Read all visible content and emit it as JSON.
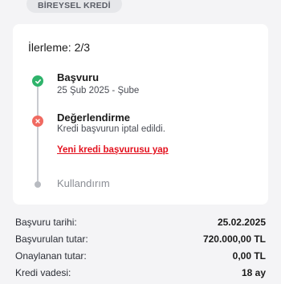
{
  "header": {
    "badge": "BİREYSEL KREDİ"
  },
  "progress": {
    "title": "İlerleme: 2/3",
    "steps": [
      {
        "title": "Başvuru",
        "subtitle": "25 Şub 2025 - Şube",
        "status": "completed",
        "icon": "check-icon"
      },
      {
        "title": "Değerlendirme",
        "subtitle": "Kredi başvurun iptal edildi.",
        "status": "failed",
        "icon": "close-icon",
        "link": "Yeni kredi başvurusu yap"
      },
      {
        "title": "Kullandırım",
        "status": "pending",
        "icon": "dot-icon"
      }
    ]
  },
  "details": [
    {
      "label": "Başvuru tarihi:",
      "value": "25.02.2025"
    },
    {
      "label": "Başvurulan tutar:",
      "value": "720.000,00 TL"
    },
    {
      "label": "Onaylanan tutar:",
      "value": "0,00 TL"
    },
    {
      "label": "Kredi vadesi:",
      "value": "18 ay"
    }
  ],
  "colors": {
    "success": "#2fb36b",
    "error": "#f06a61",
    "link": "#e3101d",
    "pending": "#b8bbc1",
    "background": "#f4f4f6"
  }
}
